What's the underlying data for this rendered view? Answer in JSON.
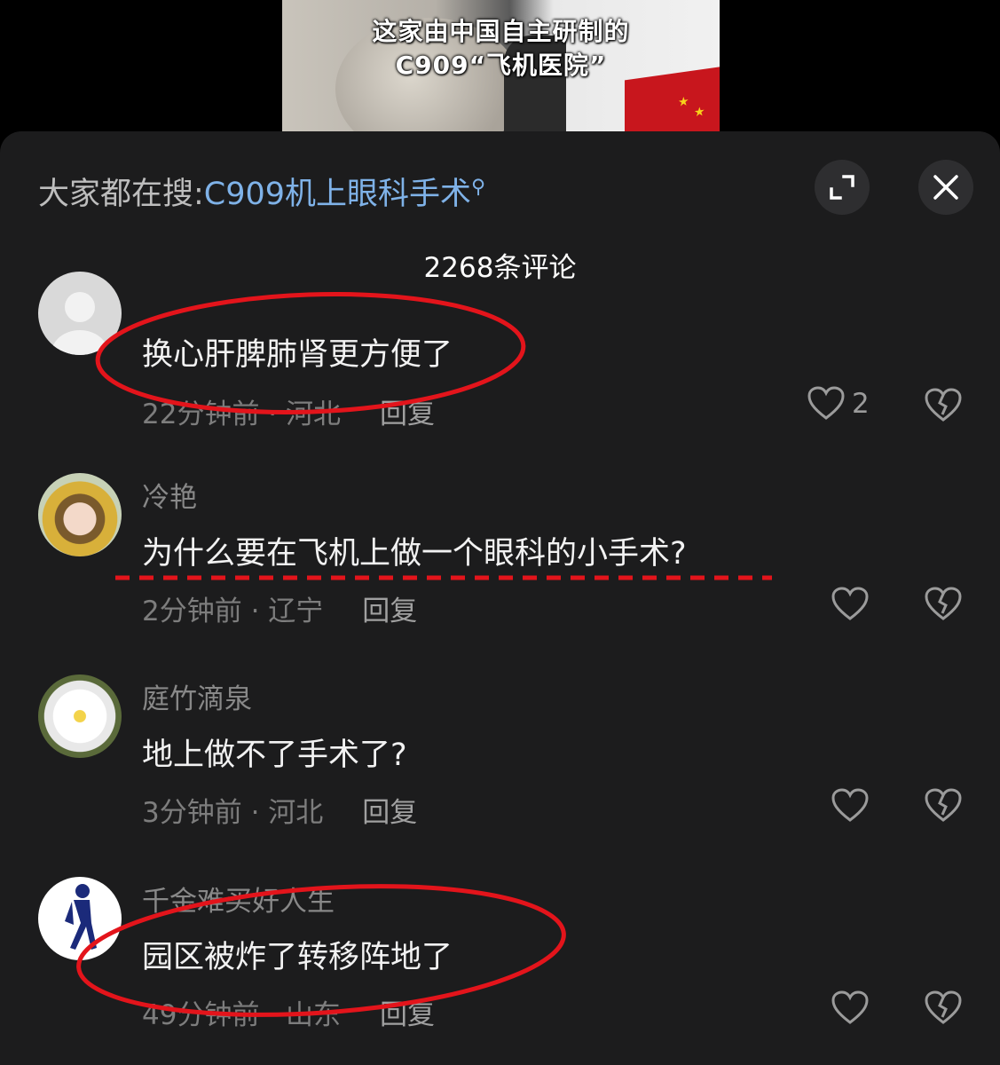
{
  "video": {
    "caption_line1": "这家由中国自主研制的",
    "caption_line2": "C909“飞机医院”"
  },
  "header": {
    "search_prefix": "大家都在搜:",
    "search_query": "C909机上眼科手术",
    "search_icon": "search-icon",
    "expand_icon": "expand-icon",
    "close_icon": "close-icon"
  },
  "comments_count": "2268条评论",
  "comments": [
    {
      "username": "",
      "text": "换心肝脾肺肾更方便了",
      "time_location": "22分钟前 · 河北",
      "reply": "回复",
      "likes": "2"
    },
    {
      "username": "冷艳",
      "text": "为什么要在飞机上做一个眼科的小手术?",
      "time_location": "2分钟前 · 辽宁",
      "reply": "回复",
      "likes": ""
    },
    {
      "username": "庭竹滴泉",
      "text": "地上做不了手术了?",
      "time_location": "3分钟前 · 河北",
      "reply": "回复",
      "likes": ""
    },
    {
      "username": "千金难买好人生",
      "text": "园区被炸了转移阵地了",
      "time_location": "49分钟前 · 山东",
      "reply": "回复",
      "likes": ""
    }
  ],
  "colors": {
    "sheet_bg": "#1c1c1d",
    "link_blue": "#7fb2e8",
    "annotation_red": "#e3141b"
  }
}
